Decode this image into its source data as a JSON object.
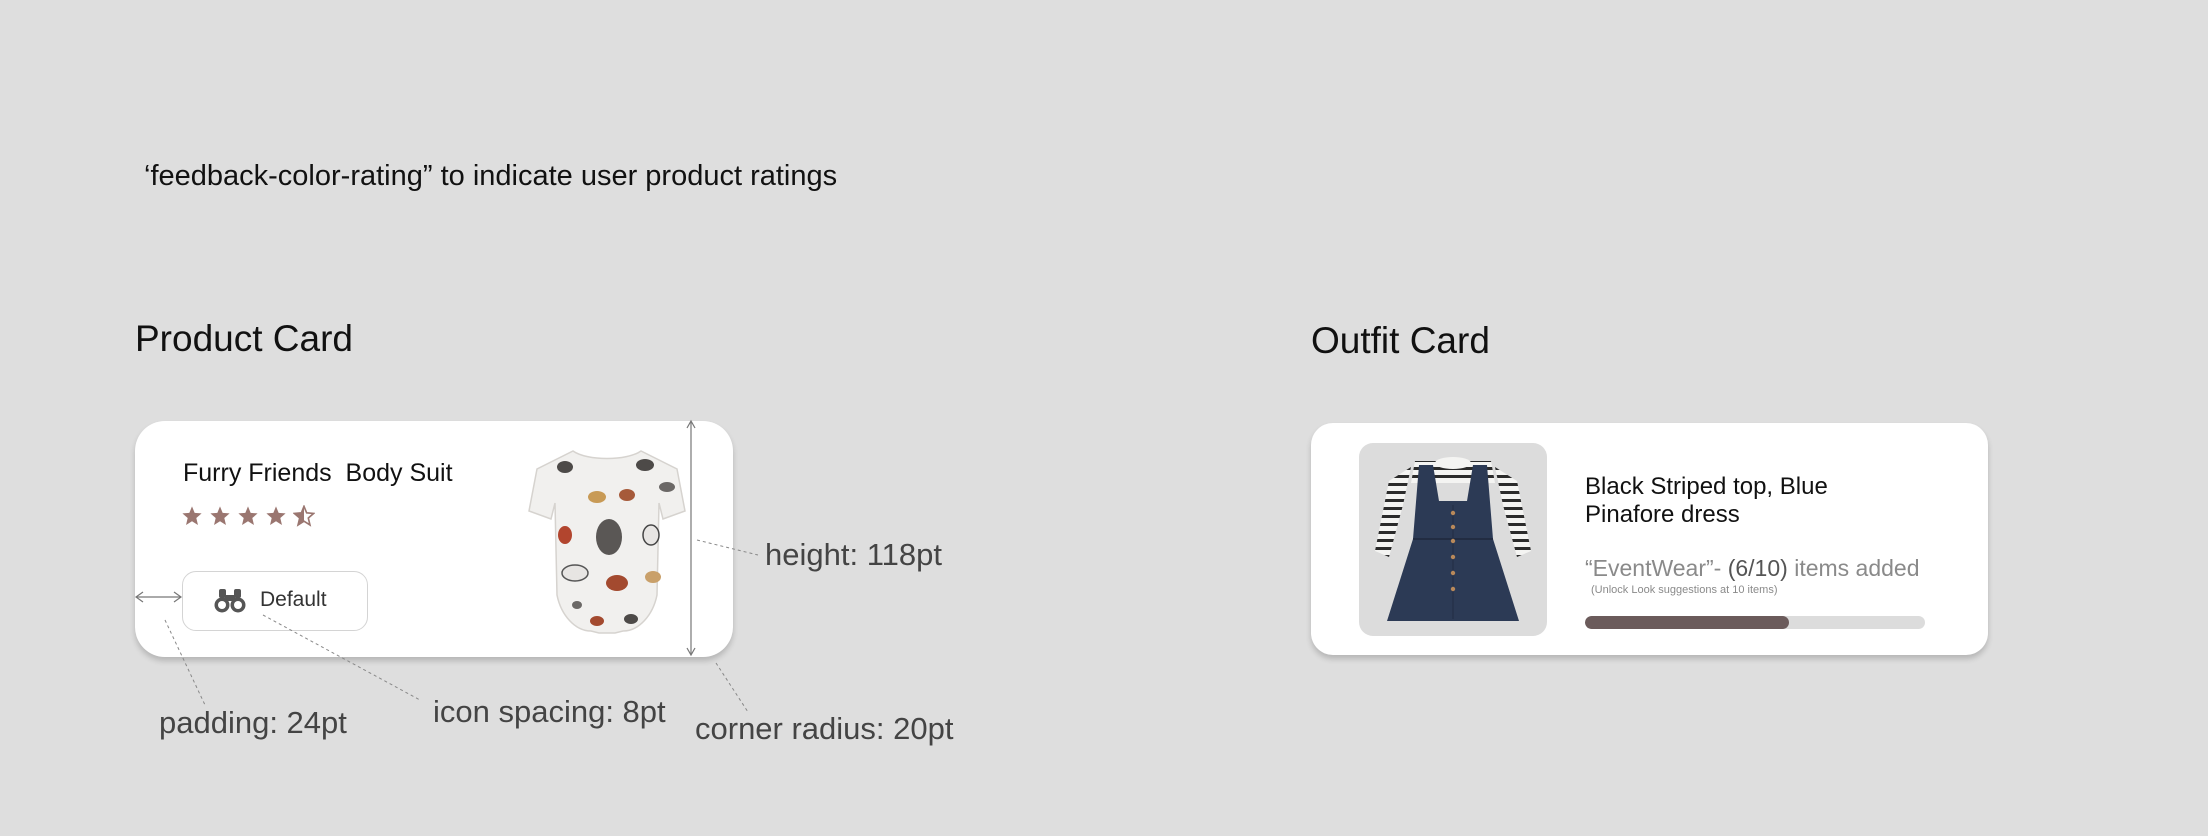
{
  "note": {
    "text": "‘feedback-color-rating” to indicate user product ratings"
  },
  "product_section": {
    "title": "Product Card",
    "card": {
      "name": "Furry Friends  Body Suit",
      "rating": 4.5,
      "rating_max": 5,
      "rating_color": "#9a7670",
      "button_label": "Default",
      "button_icon": "binoculars-icon",
      "image": "dog-print-bodysuit"
    },
    "annotations": {
      "height": "height: 118pt",
      "padding": "padding: 24pt",
      "icon_spacing": "icon spacing: 8pt",
      "corner_radius": "corner radius: 20pt"
    }
  },
  "outfit_section": {
    "title": "Outfit Card",
    "card": {
      "image": "striped-top-pinafore-dress",
      "title": "Black Striped top, Blue Pinafore dress",
      "collection": "“EventWear”- ",
      "count": "(6/10)",
      "items_text": " items added",
      "hint": "(Unlock Look suggestions at 10 items)",
      "progress": 0.6,
      "progress_color": "#6b5b5b"
    }
  }
}
